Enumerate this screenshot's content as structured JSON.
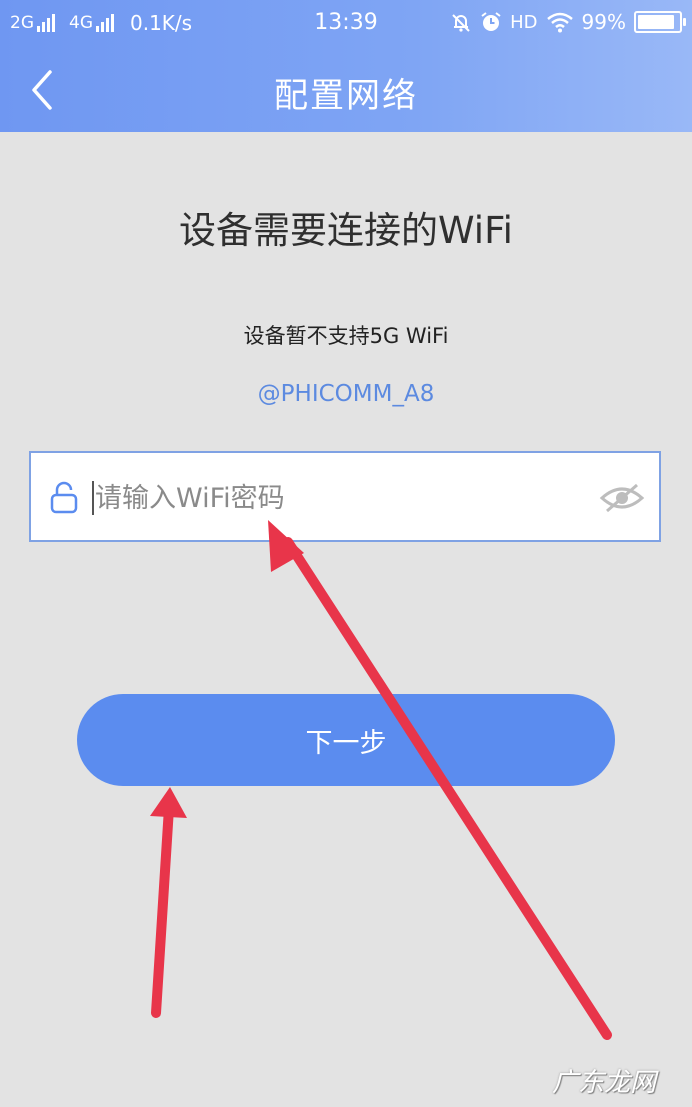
{
  "status_bar": {
    "sim1": "2G",
    "sim2": "4G",
    "speed": "0.1K/s",
    "time": "13:39",
    "hd": "HD",
    "battery": "99%",
    "battery_level": 0.99
  },
  "nav": {
    "title": "配置网络",
    "back_icon": "chevron-left-icon"
  },
  "main": {
    "heading": "设备需要连接的WiFi",
    "notice": "设备暂不支持5G WiFi",
    "ssid": "@PHICOMM_A8",
    "password": {
      "value": "",
      "placeholder": "请输入WiFi密码",
      "lock_icon": "lock-icon",
      "toggle_icon": "eye-off-icon"
    },
    "next_label": "下一步"
  },
  "annotations": {
    "arrow_color": "#e8354a",
    "watermark": "广东龙网"
  },
  "colors": {
    "accent": "#5b8cef",
    "header": "#7fa5f4"
  }
}
